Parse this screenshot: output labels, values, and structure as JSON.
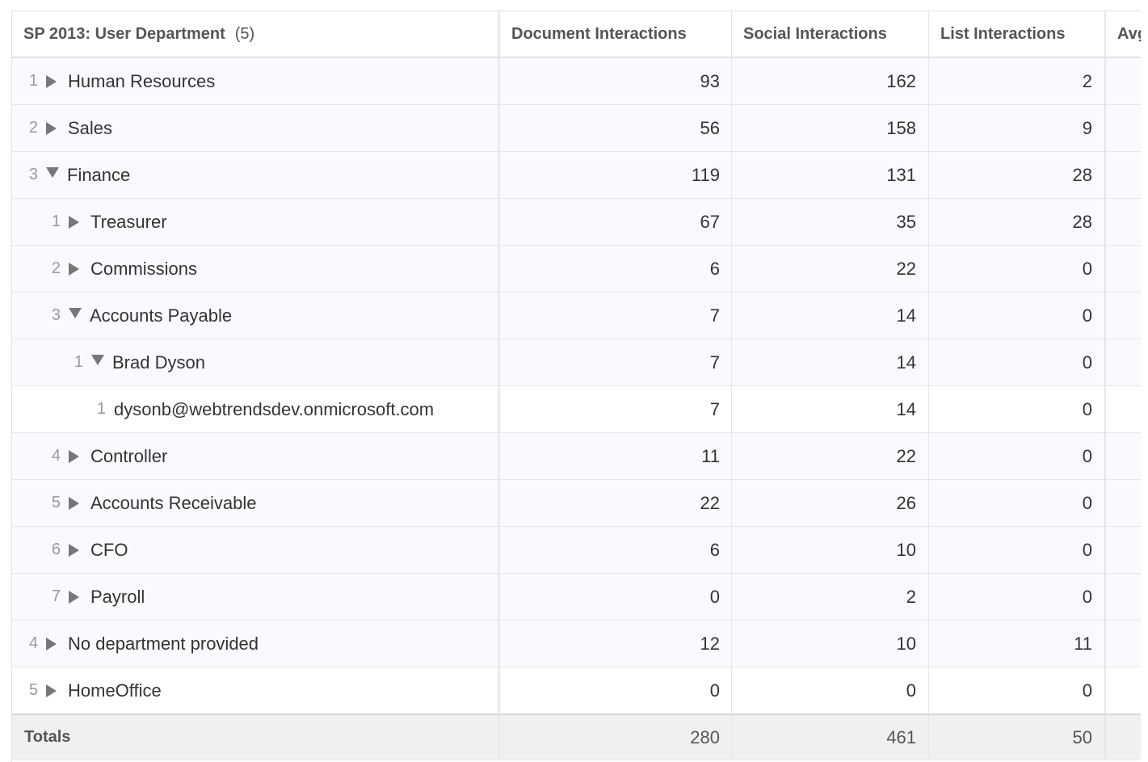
{
  "header": {
    "dimension": "SP 2013: User Department",
    "count": "(5)",
    "col1": "Document Interactions",
    "col2": "Social Interactions",
    "col3": "List Interactions",
    "col4": "Avg"
  },
  "rows": [
    {
      "index": "1",
      "label": "Human Resources",
      "doc": "93",
      "social": "162",
      "list": "2"
    },
    {
      "index": "2",
      "label": "Sales",
      "doc": "56",
      "social": "158",
      "list": "9"
    },
    {
      "index": "3",
      "label": "Finance",
      "doc": "119",
      "social": "131",
      "list": "28"
    },
    {
      "index": "1",
      "label": "Treasurer",
      "doc": "67",
      "social": "35",
      "list": "28"
    },
    {
      "index": "2",
      "label": "Commissions",
      "doc": "6",
      "social": "22",
      "list": "0"
    },
    {
      "index": "3",
      "label": "Accounts Payable",
      "doc": "7",
      "social": "14",
      "list": "0"
    },
    {
      "index": "1",
      "label": "Brad Dyson",
      "doc": "7",
      "social": "14",
      "list": "0"
    },
    {
      "index": "1",
      "label": "dysonb@webtrendsdev.onmicrosoft.com",
      "doc": "7",
      "social": "14",
      "list": "0"
    },
    {
      "index": "4",
      "label": "Controller",
      "doc": "11",
      "social": "22",
      "list": "0"
    },
    {
      "index": "5",
      "label": "Accounts Receivable",
      "doc": "22",
      "social": "26",
      "list": "0"
    },
    {
      "index": "6",
      "label": "CFO",
      "doc": "6",
      "social": "10",
      "list": "0"
    },
    {
      "index": "7",
      "label": "Payroll",
      "doc": "0",
      "social": "2",
      "list": "0"
    },
    {
      "index": "4",
      "label": "No department provided",
      "doc": "12",
      "social": "10",
      "list": "11"
    },
    {
      "index": "5",
      "label": "HomeOffice",
      "doc": "0",
      "social": "0",
      "list": "0"
    }
  ],
  "totals": {
    "label": "Totals",
    "doc": "280",
    "social": "461",
    "list": "50"
  }
}
